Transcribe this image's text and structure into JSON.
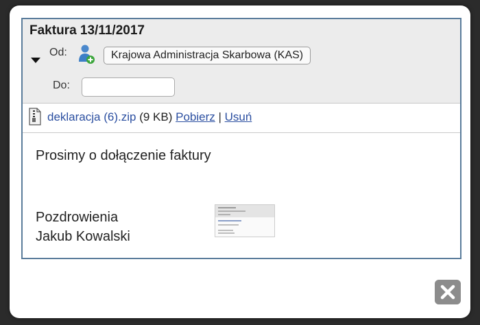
{
  "email": {
    "subject": "Faktura 13/11/2017",
    "from_label": "Od:",
    "from_value": "Krajowa Administracja Skarbowa (KAS)",
    "to_label": "Do:",
    "to_value": ""
  },
  "attachment": {
    "filename": "deklaracja (6).zip",
    "size": "(9 KB)",
    "download_label": "Pobierz",
    "separator": "|",
    "delete_label": "Usuń"
  },
  "message": {
    "line1": "Prosimy o dołączenie faktury",
    "greeting": "Pozdrowienia",
    "signature": "Jakub Kowalski"
  },
  "icons": {
    "expand": "triangle-down-icon",
    "contact": "contact-add-icon",
    "attachment": "zip-file-icon",
    "close": "close-icon"
  },
  "colors": {
    "accent_border": "#5a7c9b",
    "link": "#2a4ea0",
    "header_bg": "#ececec",
    "close_button": "#8c8c8c"
  }
}
